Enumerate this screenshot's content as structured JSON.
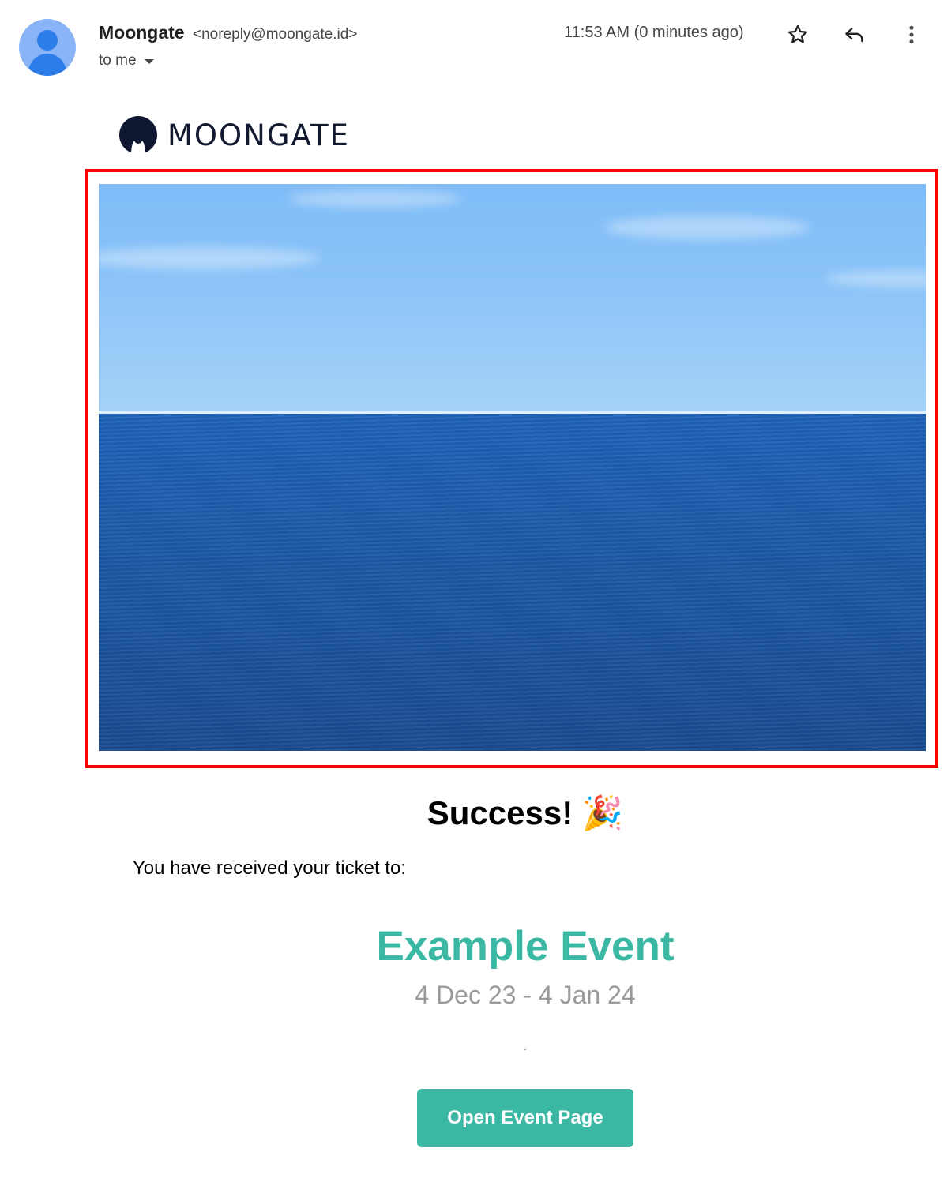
{
  "email": {
    "sender_name": "Moongate",
    "sender_address": "<noreply@moongate.id>",
    "recipient_label": "to me",
    "timestamp": "11:53 AM (0 minutes ago)",
    "actions": [
      "star-icon",
      "reply-icon",
      "more-vert-icon"
    ]
  },
  "body": {
    "brand_name": "MOONGATE",
    "hero_image": "ocean horizon photo",
    "heading": "Success!",
    "heading_emoji": "🎉",
    "intro_text": "You have received your ticket to:",
    "event_title": "Example Event",
    "event_dates": "4 Dec 23 - 4 Jan 24",
    "event_separator": ".",
    "cta_label": "Open Event Page"
  },
  "colors": {
    "accent": "#3ab8a4",
    "highlight_border": "#ff0000",
    "muted_text": "#9a9a9a"
  }
}
